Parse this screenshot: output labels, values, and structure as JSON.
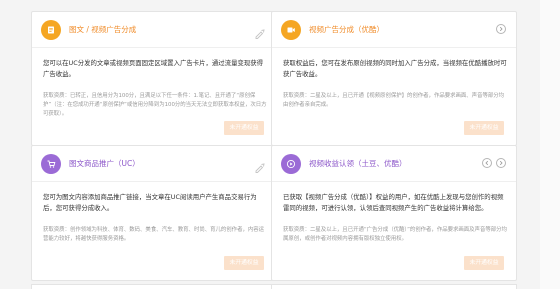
{
  "colors": {
    "accent_orange": "#f5a623",
    "accent_purple": "#9b6bd6",
    "button_disabled": "#fbe1cb"
  },
  "cards": [
    {
      "icon": "document-icon",
      "title": "图文 / 视频广告分成",
      "desc": "您可以在UC分发的文章或视频页面固定区域置入广告卡片，通过流量变现获得广告收益。",
      "req": "获取资质：已转正，且信用分为100分，且满足以下任一条件：1.笔记、且开通了“原创保护”（注：在您成功开通“原创保护”或信用分降到为100分的当天无法立即获取本权益，次日方可获取）。",
      "button": "未开通权益"
    },
    {
      "icon": "video-icon",
      "title": "视频广告分成（优酷）",
      "desc": "获取权益后，您可在发布原创视频的同时加入广告分成，当视频在优酷播放时可获广告收益。",
      "req": "获取资质：二星及以上，且已开通【视频原创保护】的创作者，作品要求画面、声音等部分均由创作者亲自完成。",
      "button": "未开通权益"
    },
    {
      "icon": "shopping-cart-icon",
      "title": "图文商品推广（UC）",
      "desc": "您可为图文内容添加商品推广链接，当文章在UC阅读用户产生商品交易行为后，您可获得分成收入。",
      "req": "获取资质：创作领域为科技、体育、数码、美食、汽车、教育、时尚、育儿的创作者，内容运营能力较好，将越快获得服务资格。",
      "button": "未开通权益"
    },
    {
      "icon": "play-circle-icon",
      "title": "视频收益认领（土豆、优酷）",
      "desc": "已获取【视频广告分成（优酷）】权益的用户，如在优酷上发现与您创作的视频雷同的视频，可进行认领，认领后查同视频产生的广告收益将计算给您。",
      "req": "获取资质：二星及以上，且已开通“广告分成（优酷）”的创作者，作品要求画面及声音等部分均属原创，或创作者对视频内容拥有版权独立使用权。",
      "button": "未开通权益"
    }
  ]
}
